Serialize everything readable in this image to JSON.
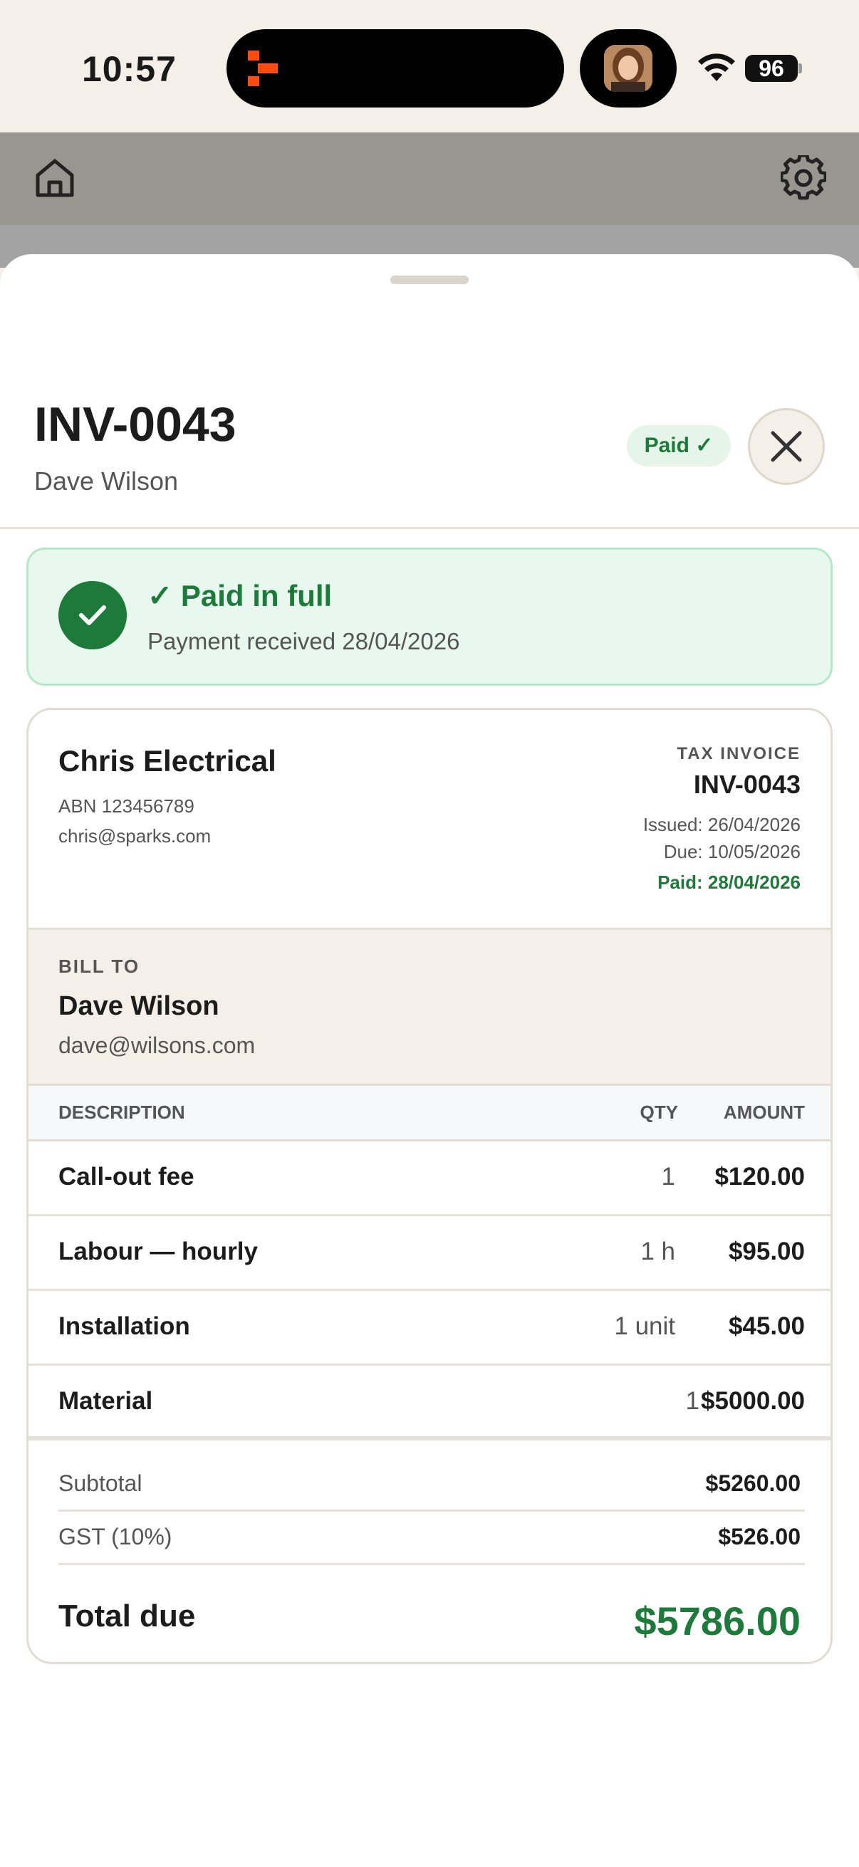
{
  "status_bar": {
    "time": "10:57",
    "battery": "96"
  },
  "header": {
    "home_icon": "home-icon",
    "settings_icon": "gear-icon"
  },
  "invoice": {
    "number": "INV-0043",
    "client": "Dave Wilson",
    "status_badge": "Paid ✓"
  },
  "banner": {
    "title": "✓ Paid in full",
    "subtitle": "Payment received 28/04/2026"
  },
  "business": {
    "name": "Chris Electrical",
    "abn": "ABN 123456789",
    "email": "chris@sparks.com"
  },
  "meta": {
    "doc_type": "TAX INVOICE",
    "number": "INV-0043",
    "issued": "Issued: 26/04/2026",
    "due": "Due: 10/05/2026",
    "paid": "Paid: 28/04/2026"
  },
  "bill_to": {
    "label": "BILL TO",
    "name": "Dave Wilson",
    "email": "dave@wilsons.com"
  },
  "table": {
    "headers": [
      "DESCRIPTION",
      "QTY",
      "AMOUNT"
    ],
    "rows": [
      {
        "description": "Call-out fee",
        "qty": "1",
        "amount": "$120.00"
      },
      {
        "description": "Labour — hourly",
        "qty": "1 h",
        "amount": "$95.00"
      },
      {
        "description": "Installation",
        "qty": "1 unit",
        "amount": "$45.00"
      },
      {
        "description": "Material",
        "qty": "1",
        "amount": "$5000.00"
      }
    ]
  },
  "totals": {
    "subtotal_label": "Subtotal",
    "subtotal": "$5260.00",
    "gst_label": "GST (10%)",
    "gst": "$526.00",
    "total_label": "Total due",
    "total": "$5786.00"
  },
  "colors": {
    "accent_green": "#1e7a3a",
    "background": "#f4efe8",
    "logo_orange": "#ff4a10"
  }
}
